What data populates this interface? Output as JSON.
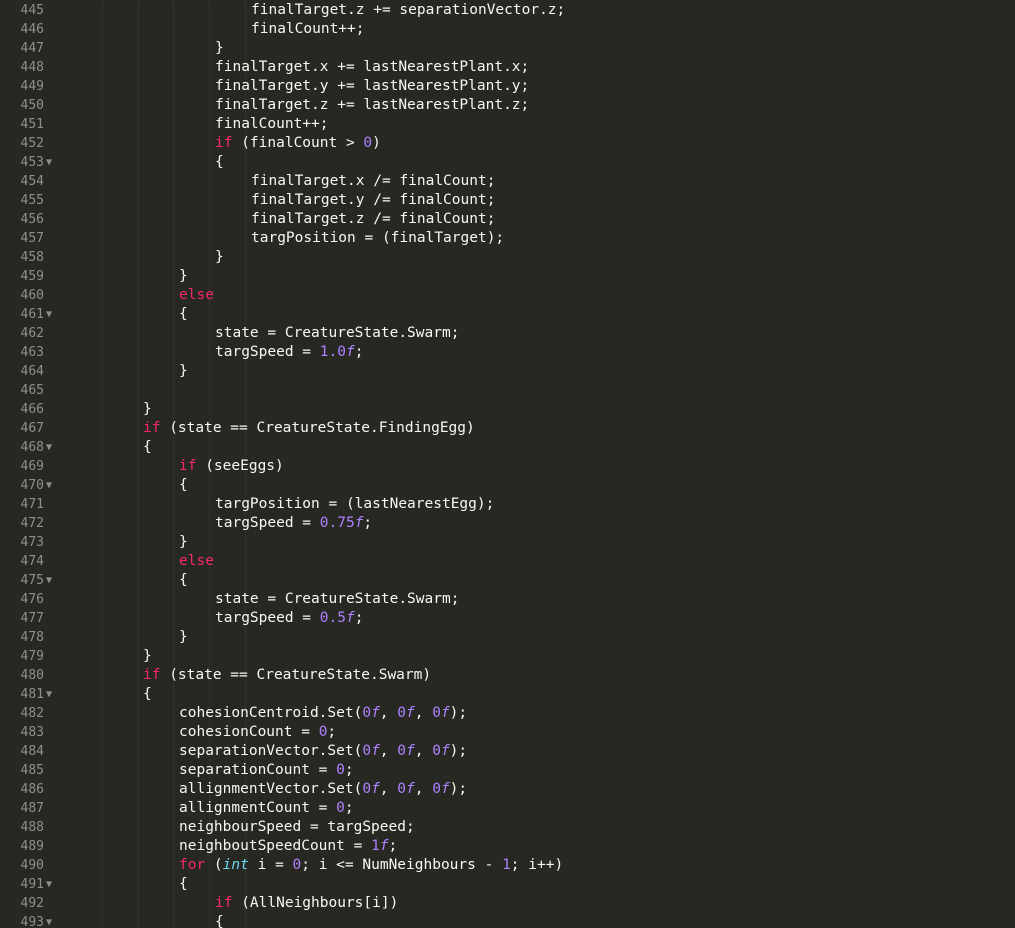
{
  "editor": {
    "colors": {
      "background": "#272822",
      "text": "#f8f8f2",
      "keyword": "#f92672",
      "number": "#ae81ff",
      "type": "#66d9ef",
      "line_number": "#90908a",
      "indent_guide": "#3b3a32"
    },
    "fold_icon": "triangle-down-icon",
    "lines": [
      {
        "n": "445",
        "fold": false,
        "indent": 3,
        "tokens": [
          {
            "t": "finalTarget.z += separationVector.z;",
            "c": ""
          }
        ]
      },
      {
        "n": "446",
        "fold": false,
        "indent": 3,
        "tokens": [
          {
            "t": "finalCount++;",
            "c": ""
          }
        ]
      },
      {
        "n": "447",
        "fold": false,
        "indent": 2,
        "tokens": [
          {
            "t": "}",
            "c": ""
          }
        ]
      },
      {
        "n": "448",
        "fold": false,
        "indent": 2,
        "tokens": [
          {
            "t": "finalTarget.x += lastNearestPlant.x;",
            "c": ""
          }
        ]
      },
      {
        "n": "449",
        "fold": false,
        "indent": 2,
        "tokens": [
          {
            "t": "finalTarget.y += lastNearestPlant.y;",
            "c": ""
          }
        ]
      },
      {
        "n": "450",
        "fold": false,
        "indent": 2,
        "tokens": [
          {
            "t": "finalTarget.z += lastNearestPlant.z;",
            "c": ""
          }
        ]
      },
      {
        "n": "451",
        "fold": false,
        "indent": 2,
        "tokens": [
          {
            "t": "finalCount++;",
            "c": ""
          }
        ]
      },
      {
        "n": "452",
        "fold": false,
        "indent": 2,
        "tokens": [
          {
            "t": "if",
            "c": "kw"
          },
          {
            "t": " (finalCount > ",
            "c": ""
          },
          {
            "t": "0",
            "c": "num"
          },
          {
            "t": ")",
            "c": ""
          }
        ]
      },
      {
        "n": "453",
        "fold": true,
        "indent": 2,
        "tokens": [
          {
            "t": "{",
            "c": ""
          }
        ]
      },
      {
        "n": "454",
        "fold": false,
        "indent": 3,
        "tokens": [
          {
            "t": "finalTarget.x /= finalCount;",
            "c": ""
          }
        ]
      },
      {
        "n": "455",
        "fold": false,
        "indent": 3,
        "tokens": [
          {
            "t": "finalTarget.y /= finalCount;",
            "c": ""
          }
        ]
      },
      {
        "n": "456",
        "fold": false,
        "indent": 3,
        "tokens": [
          {
            "t": "finalTarget.z /= finalCount;",
            "c": ""
          }
        ]
      },
      {
        "n": "457",
        "fold": false,
        "indent": 3,
        "tokens": [
          {
            "t": "targPosition = (finalTarget);",
            "c": ""
          }
        ]
      },
      {
        "n": "458",
        "fold": false,
        "indent": 2,
        "tokens": [
          {
            "t": "}",
            "c": ""
          }
        ]
      },
      {
        "n": "459",
        "fold": false,
        "indent": 1,
        "tokens": [
          {
            "t": "}",
            "c": ""
          }
        ]
      },
      {
        "n": "460",
        "fold": false,
        "indent": 1,
        "tokens": [
          {
            "t": "else",
            "c": "kw"
          }
        ]
      },
      {
        "n": "461",
        "fold": true,
        "indent": 1,
        "tokens": [
          {
            "t": "{",
            "c": ""
          }
        ]
      },
      {
        "n": "462",
        "fold": false,
        "indent": 2,
        "tokens": [
          {
            "t": "state = CreatureState.Swarm;",
            "c": ""
          }
        ]
      },
      {
        "n": "463",
        "fold": false,
        "indent": 2,
        "tokens": [
          {
            "t": "targSpeed = ",
            "c": ""
          },
          {
            "t": "1.0",
            "c": "num"
          },
          {
            "t": "f",
            "c": "num it"
          },
          {
            "t": ";",
            "c": ""
          }
        ]
      },
      {
        "n": "464",
        "fold": false,
        "indent": 1,
        "tokens": [
          {
            "t": "}",
            "c": ""
          }
        ]
      },
      {
        "n": "465",
        "fold": false,
        "indent": 0,
        "tokens": []
      },
      {
        "n": "466",
        "fold": false,
        "indent": 0,
        "tokens": [
          {
            "t": "}",
            "c": ""
          }
        ]
      },
      {
        "n": "467",
        "fold": false,
        "indent": 0,
        "tokens": [
          {
            "t": "if",
            "c": "kw"
          },
          {
            "t": " (state == CreatureState.FindingEgg)",
            "c": ""
          }
        ]
      },
      {
        "n": "468",
        "fold": true,
        "indent": 0,
        "tokens": [
          {
            "t": "{",
            "c": ""
          }
        ]
      },
      {
        "n": "469",
        "fold": false,
        "indent": 1,
        "tokens": [
          {
            "t": "if",
            "c": "kw"
          },
          {
            "t": " (seeEggs)",
            "c": ""
          }
        ]
      },
      {
        "n": "470",
        "fold": true,
        "indent": 1,
        "tokens": [
          {
            "t": "{",
            "c": ""
          }
        ]
      },
      {
        "n": "471",
        "fold": false,
        "indent": 2,
        "tokens": [
          {
            "t": "targPosition = (lastNearestEgg);",
            "c": ""
          }
        ]
      },
      {
        "n": "472",
        "fold": false,
        "indent": 2,
        "tokens": [
          {
            "t": "targSpeed = ",
            "c": ""
          },
          {
            "t": "0.75",
            "c": "num"
          },
          {
            "t": "f",
            "c": "num it"
          },
          {
            "t": ";",
            "c": ""
          }
        ]
      },
      {
        "n": "473",
        "fold": false,
        "indent": 1,
        "tokens": [
          {
            "t": "}",
            "c": ""
          }
        ]
      },
      {
        "n": "474",
        "fold": false,
        "indent": 1,
        "tokens": [
          {
            "t": "else",
            "c": "kw"
          }
        ]
      },
      {
        "n": "475",
        "fold": true,
        "indent": 1,
        "tokens": [
          {
            "t": "{",
            "c": ""
          }
        ]
      },
      {
        "n": "476",
        "fold": false,
        "indent": 2,
        "tokens": [
          {
            "t": "state = CreatureState.Swarm;",
            "c": ""
          }
        ]
      },
      {
        "n": "477",
        "fold": false,
        "indent": 2,
        "tokens": [
          {
            "t": "targSpeed = ",
            "c": ""
          },
          {
            "t": "0.5",
            "c": "num"
          },
          {
            "t": "f",
            "c": "num it"
          },
          {
            "t": ";",
            "c": ""
          }
        ]
      },
      {
        "n": "478",
        "fold": false,
        "indent": 1,
        "tokens": [
          {
            "t": "}",
            "c": ""
          }
        ]
      },
      {
        "n": "479",
        "fold": false,
        "indent": 0,
        "tokens": [
          {
            "t": "}",
            "c": ""
          }
        ]
      },
      {
        "n": "480",
        "fold": false,
        "indent": 0,
        "tokens": [
          {
            "t": "if",
            "c": "kw"
          },
          {
            "t": " (state == CreatureState.Swarm)",
            "c": ""
          }
        ]
      },
      {
        "n": "481",
        "fold": true,
        "indent": 0,
        "tokens": [
          {
            "t": "{",
            "c": ""
          }
        ]
      },
      {
        "n": "482",
        "fold": false,
        "indent": 1,
        "tokens": [
          {
            "t": "cohesionCentroid.Set(",
            "c": ""
          },
          {
            "t": "0",
            "c": "num"
          },
          {
            "t": "f",
            "c": "num it"
          },
          {
            "t": ", ",
            "c": ""
          },
          {
            "t": "0",
            "c": "num"
          },
          {
            "t": "f",
            "c": "num it"
          },
          {
            "t": ", ",
            "c": ""
          },
          {
            "t": "0",
            "c": "num"
          },
          {
            "t": "f",
            "c": "num it"
          },
          {
            "t": ");",
            "c": ""
          }
        ]
      },
      {
        "n": "483",
        "fold": false,
        "indent": 1,
        "tokens": [
          {
            "t": "cohesionCount = ",
            "c": ""
          },
          {
            "t": "0",
            "c": "num"
          },
          {
            "t": ";",
            "c": ""
          }
        ]
      },
      {
        "n": "484",
        "fold": false,
        "indent": 1,
        "tokens": [
          {
            "t": "separationVector.Set(",
            "c": ""
          },
          {
            "t": "0",
            "c": "num"
          },
          {
            "t": "f",
            "c": "num it"
          },
          {
            "t": ", ",
            "c": ""
          },
          {
            "t": "0",
            "c": "num"
          },
          {
            "t": "f",
            "c": "num it"
          },
          {
            "t": ", ",
            "c": ""
          },
          {
            "t": "0",
            "c": "num"
          },
          {
            "t": "f",
            "c": "num it"
          },
          {
            "t": ");",
            "c": ""
          }
        ]
      },
      {
        "n": "485",
        "fold": false,
        "indent": 1,
        "tokens": [
          {
            "t": "separationCount = ",
            "c": ""
          },
          {
            "t": "0",
            "c": "num"
          },
          {
            "t": ";",
            "c": ""
          }
        ]
      },
      {
        "n": "486",
        "fold": false,
        "indent": 1,
        "tokens": [
          {
            "t": "allignmentVector.Set(",
            "c": ""
          },
          {
            "t": "0",
            "c": "num"
          },
          {
            "t": "f",
            "c": "num it"
          },
          {
            "t": ", ",
            "c": ""
          },
          {
            "t": "0",
            "c": "num"
          },
          {
            "t": "f",
            "c": "num it"
          },
          {
            "t": ", ",
            "c": ""
          },
          {
            "t": "0",
            "c": "num"
          },
          {
            "t": "f",
            "c": "num it"
          },
          {
            "t": ");",
            "c": ""
          }
        ]
      },
      {
        "n": "487",
        "fold": false,
        "indent": 1,
        "tokens": [
          {
            "t": "allignmentCount = ",
            "c": ""
          },
          {
            "t": "0",
            "c": "num"
          },
          {
            "t": ";",
            "c": ""
          }
        ]
      },
      {
        "n": "488",
        "fold": false,
        "indent": 1,
        "tokens": [
          {
            "t": "neighbourSpeed = targSpeed;",
            "c": ""
          }
        ]
      },
      {
        "n": "489",
        "fold": false,
        "indent": 1,
        "tokens": [
          {
            "t": "neighboutSpeedCount = ",
            "c": ""
          },
          {
            "t": "1",
            "c": "num"
          },
          {
            "t": "f",
            "c": "num it"
          },
          {
            "t": ";",
            "c": ""
          }
        ]
      },
      {
        "n": "490",
        "fold": false,
        "indent": 1,
        "tokens": [
          {
            "t": "for",
            "c": "kw"
          },
          {
            "t": " (",
            "c": ""
          },
          {
            "t": "int",
            "c": "type"
          },
          {
            "t": " i = ",
            "c": ""
          },
          {
            "t": "0",
            "c": "num"
          },
          {
            "t": "; i <= NumNeighbours - ",
            "c": ""
          },
          {
            "t": "1",
            "c": "num"
          },
          {
            "t": "; i++)",
            "c": ""
          }
        ]
      },
      {
        "n": "491",
        "fold": true,
        "indent": 1,
        "tokens": [
          {
            "t": "{",
            "c": ""
          }
        ]
      },
      {
        "n": "492",
        "fold": false,
        "indent": 2,
        "tokens": [
          {
            "t": "if",
            "c": "kw"
          },
          {
            "t": " (AllNeighbours[i])",
            "c": ""
          }
        ]
      },
      {
        "n": "493",
        "fold": true,
        "indent": 2,
        "tokens": [
          {
            "t": "{",
            "c": ""
          }
        ]
      }
    ]
  }
}
